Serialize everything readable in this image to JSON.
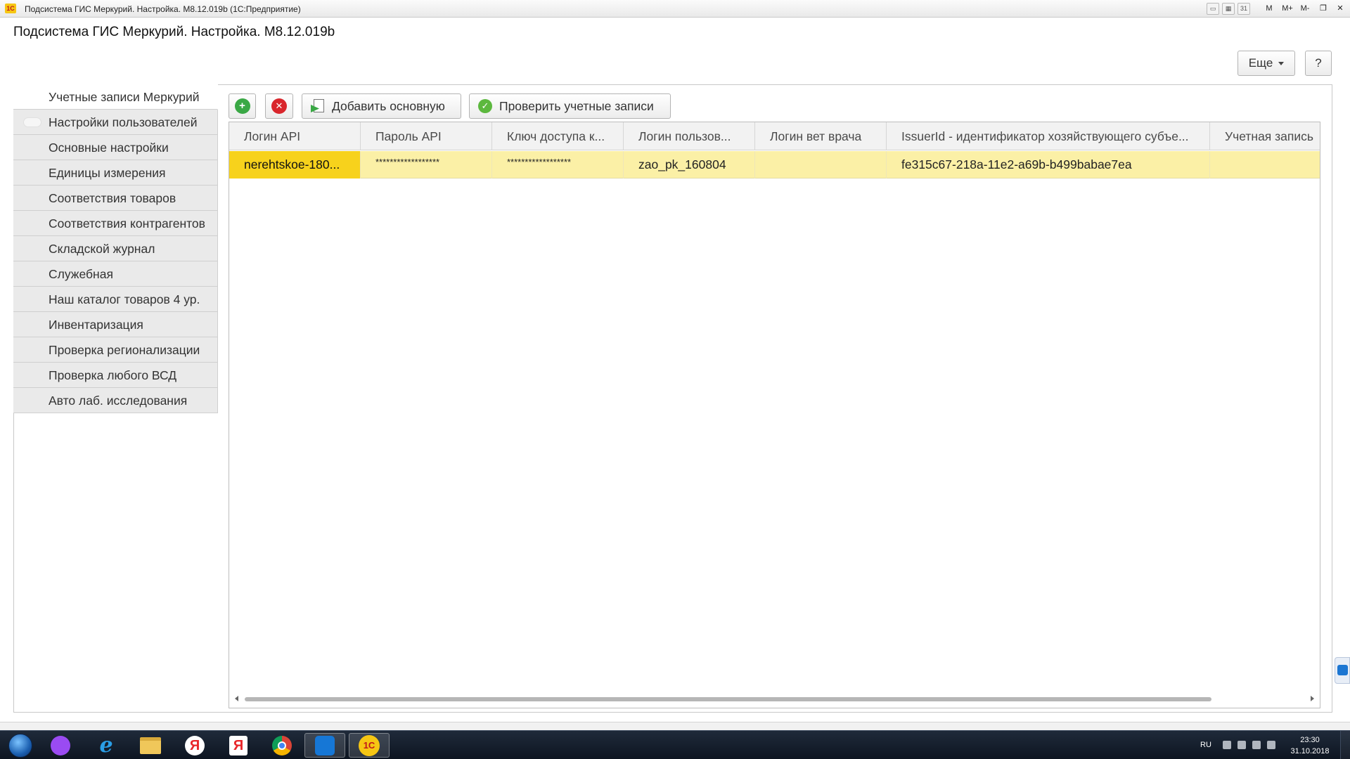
{
  "window": {
    "title": "Подсистема ГИС Меркурий. Настройка. М8.12.019b  (1С:Предприятие)",
    "logo": "1С",
    "tools": [
      "M",
      "M+",
      "M-"
    ]
  },
  "header": {
    "page_title": "Подсистема ГИС Меркурий. Настройка. М8.12.019b",
    "more_label": "Еще",
    "help_label": "?"
  },
  "nav": {
    "items": [
      {
        "label": "Учетные записи Меркурий",
        "active": true
      },
      {
        "label": "Настройки пользователей"
      },
      {
        "label": "Основные настройки"
      },
      {
        "label": "Единицы измерения"
      },
      {
        "label": "Соответствия товаров"
      },
      {
        "label": "Соответствия контрагентов"
      },
      {
        "label": "Складской журнал"
      },
      {
        "label": "Служебная"
      },
      {
        "label": "Наш каталог товаров 4 ур."
      },
      {
        "label": "Инвентаризация"
      },
      {
        "label": "Проверка регионализации"
      },
      {
        "label": "Проверка любого ВСД"
      },
      {
        "label": "Авто лаб. исследования"
      }
    ]
  },
  "toolbar": {
    "add_primary_label": "Добавить основную",
    "check_accounts_label": "Проверить учетные записи"
  },
  "table": {
    "columns": [
      "Логин API",
      "Пароль API",
      "Ключ доступа к...",
      "Логин пользов...",
      "Логин вет врача",
      "IssuerId - идентификатор хозяйствующего субъе...",
      "Учетная запись"
    ],
    "rows": [
      [
        "nerehtskoe-180...",
        "******************",
        "******************",
        "zao_pk_160804",
        "",
        "fe315c67-218a-11e2-a69b-b499babae7ea",
        ""
      ]
    ]
  },
  "taskbar": {
    "lang": "RU",
    "time": "23:30",
    "date": "31.10.2018",
    "apps": [
      "start-orb",
      "alice",
      "internet-explorer",
      "file-explorer",
      "yandex-browser",
      "yandex",
      "chrome",
      "teamviewer",
      "1c-enterprise"
    ],
    "y_label": "Я",
    "ie_label": "e",
    "onec_label": "1С"
  },
  "colors": {
    "selected_row": "#fbf0a6",
    "current_cell": "#f7d21c",
    "nav_bg": "#eaeaea"
  }
}
